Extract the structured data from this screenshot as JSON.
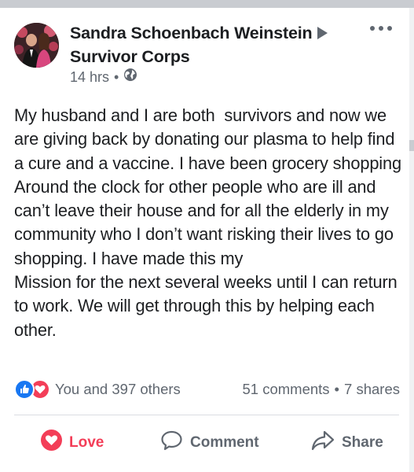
{
  "post": {
    "author": "Sandra Schoenbach Weinstein",
    "group": "Survivor Corps",
    "time": "14 hrs",
    "text": "My husband and I are both  survivors and now we are giving back by donating our plasma to help find a cure and a vaccine. I have been grocery shopping Around the clock for other people who are ill and can’t leave their house and for all the elderly in my community who I don’t want risking their lives to go shopping. I have made this my\nMission for the next several weeks until I can return to work. We will get through this by helping each other."
  },
  "engagement": {
    "reactions_text": "You and 397 others",
    "comments": "51 comments",
    "shares": "7 shares"
  },
  "actions": {
    "love": "Love",
    "comment": "Comment",
    "share": "Share"
  },
  "colors": {
    "love": "#f33e58",
    "like": "#1877f2",
    "secondary_text": "#606770"
  },
  "icons": [
    "triangle-right-icon",
    "globe-icon",
    "more-options-icon",
    "like-reaction-icon",
    "love-reaction-icon",
    "heart-icon",
    "comment-icon",
    "share-icon"
  ]
}
